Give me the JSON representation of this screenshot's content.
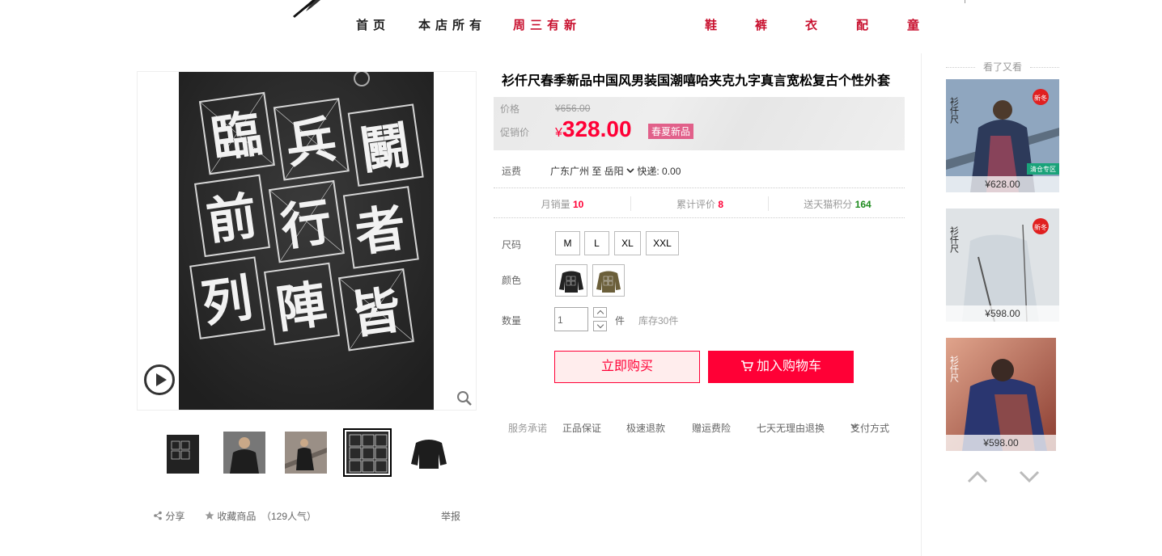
{
  "nav": {
    "items": [
      "首页",
      "本店所有",
      "周三有新",
      "鞋",
      "裤",
      "衣",
      "配",
      "童"
    ]
  },
  "gallery": {
    "thumbnails": [
      "thumb-1",
      "thumb-2",
      "thumb-3",
      "thumb-4",
      "thumb-5"
    ],
    "active_index": 3,
    "calligraphy": [
      "臨",
      "兵",
      "鬭",
      "前",
      "行",
      "者",
      "列",
      "陣",
      "皆"
    ],
    "share_label": "分享",
    "favorite_label": "收藏商品",
    "favorite_count": "（129人气）",
    "report_label": "举报"
  },
  "product": {
    "title": "衫仟尺春季新品中国风男装国潮嘻哈夹克九字真言宽松复古个性外套",
    "price_label": "价格",
    "original_price": "¥656.00",
    "promo_label": "促销价",
    "currency": "¥",
    "promo_price": "328.00",
    "promo_tag": "春夏新品",
    "shipping_label": "运费",
    "shipping_text": "广东广州  至  岳阳",
    "shipping_method": "快递: 0.00",
    "stats": {
      "monthly_sales_label": "月销量",
      "monthly_sales": "10",
      "reviews_label": "累计评价",
      "reviews": "8",
      "points_label": "送天猫积分",
      "points": "164"
    },
    "size_label": "尺码",
    "sizes": [
      "M",
      "L",
      "XL",
      "XXL"
    ],
    "color_label": "颜色",
    "qty_label": "数量",
    "qty_value": "1",
    "qty_unit": "件",
    "stock": "库存30件",
    "buy_now": "立即购买",
    "add_cart": "加入购物车",
    "services_label": "服务承诺",
    "services": [
      "正品保证",
      "极速退款",
      "赠运费险",
      "七天无理由退换"
    ],
    "payment_label": "支付方式"
  },
  "sidebar": {
    "title": "看了又看",
    "items": [
      {
        "price": "¥628.00",
        "badge": "新冬",
        "tag": "清仓专区"
      },
      {
        "price": "¥598.00",
        "badge": "新冬"
      },
      {
        "price": "¥598.00"
      }
    ],
    "brand_mark": "衫仟尺"
  },
  "colors": {
    "accent": "#ff0036",
    "nav_red": "#c8102e",
    "tag_pink": "#e1608a",
    "green": "#1d8a1d"
  }
}
